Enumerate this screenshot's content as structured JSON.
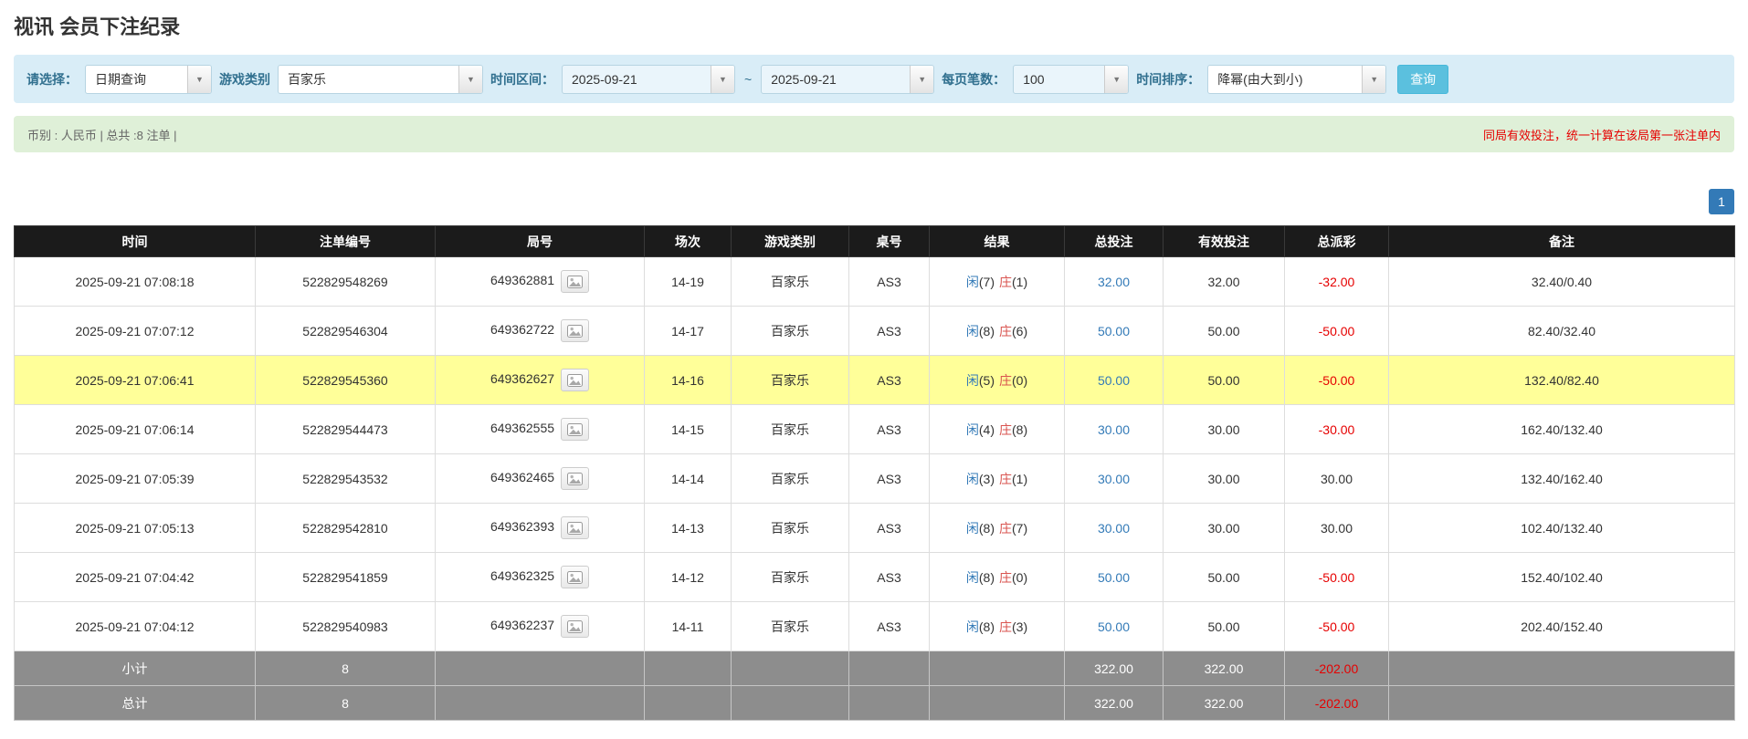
{
  "page": {
    "title": "视讯 会员下注纪录"
  },
  "icons": {
    "caret": "▼"
  },
  "filters": {
    "select_label": "请选择：",
    "select_value": "日期查询",
    "game_type_label": "游戏类别",
    "game_type_value": "百家乐",
    "time_range_label": "时间区间：",
    "date_from": "2025-09-21",
    "tilde": "~",
    "date_to": "2025-09-21",
    "page_size_label": "每页笔数：",
    "page_size_value": "100",
    "sort_label": "时间排序：",
    "sort_value": "降幂(由大到小)",
    "search_button": "查询"
  },
  "summary": {
    "left": "币别 : 人民币 | 总共 :8 注单 |",
    "right": "同局有效投注，统一计算在该局第一张注单内"
  },
  "pagination": {
    "page": "1"
  },
  "table": {
    "headers": [
      "时间",
      "注单编号",
      "局号",
      "场次",
      "游戏类别",
      "桌号",
      "结果",
      "总投注",
      "有效投注",
      "总派彩",
      "备注"
    ],
    "rows": [
      {
        "time": "2025-09-21 07:08:18",
        "bet_id": "522829548269",
        "round_id": "649362881",
        "session": "14-19",
        "game": "百家乐",
        "table_no": "AS3",
        "result": {
          "player_label": "闲",
          "player_score": "(7)",
          "banker_label": "庄",
          "banker_score": "(1)"
        },
        "total_bet": "32.00",
        "valid_bet": "32.00",
        "payout": "-32.00",
        "remark": "32.40/0.40",
        "highlighted": false
      },
      {
        "time": "2025-09-21 07:07:12",
        "bet_id": "522829546304",
        "round_id": "649362722",
        "session": "14-17",
        "game": "百家乐",
        "table_no": "AS3",
        "result": {
          "player_label": "闲",
          "player_score": "(8)",
          "banker_label": "庄",
          "banker_score": "(6)"
        },
        "total_bet": "50.00",
        "valid_bet": "50.00",
        "payout": "-50.00",
        "remark": "82.40/32.40",
        "highlighted": false
      },
      {
        "time": "2025-09-21 07:06:41",
        "bet_id": "522829545360",
        "round_id": "649362627",
        "session": "14-16",
        "game": "百家乐",
        "table_no": "AS3",
        "result": {
          "player_label": "闲",
          "player_score": "(5)",
          "banker_label": "庄",
          "banker_score": "(0)"
        },
        "total_bet": "50.00",
        "valid_bet": "50.00",
        "payout": "-50.00",
        "remark": "132.40/82.40",
        "highlighted": true
      },
      {
        "time": "2025-09-21 07:06:14",
        "bet_id": "522829544473",
        "round_id": "649362555",
        "session": "14-15",
        "game": "百家乐",
        "table_no": "AS3",
        "result": {
          "player_label": "闲",
          "player_score": "(4)",
          "banker_label": "庄",
          "banker_score": "(8)"
        },
        "total_bet": "30.00",
        "valid_bet": "30.00",
        "payout": "-30.00",
        "remark": "162.40/132.40",
        "highlighted": false
      },
      {
        "time": "2025-09-21 07:05:39",
        "bet_id": "522829543532",
        "round_id": "649362465",
        "session": "14-14",
        "game": "百家乐",
        "table_no": "AS3",
        "result": {
          "player_label": "闲",
          "player_score": "(3)",
          "banker_label": "庄",
          "banker_score": "(1)"
        },
        "total_bet": "30.00",
        "valid_bet": "30.00",
        "payout": "30.00",
        "remark": "132.40/162.40",
        "highlighted": false
      },
      {
        "time": "2025-09-21 07:05:13",
        "bet_id": "522829542810",
        "round_id": "649362393",
        "session": "14-13",
        "game": "百家乐",
        "table_no": "AS3",
        "result": {
          "player_label": "闲",
          "player_score": "(8)",
          "banker_label": "庄",
          "banker_score": "(7)"
        },
        "total_bet": "30.00",
        "valid_bet": "30.00",
        "payout": "30.00",
        "remark": "102.40/132.40",
        "highlighted": false
      },
      {
        "time": "2025-09-21 07:04:42",
        "bet_id": "522829541859",
        "round_id": "649362325",
        "session": "14-12",
        "game": "百家乐",
        "table_no": "AS3",
        "result": {
          "player_label": "闲",
          "player_score": "(8)",
          "banker_label": "庄",
          "banker_score": "(0)"
        },
        "total_bet": "50.00",
        "valid_bet": "50.00",
        "payout": "-50.00",
        "remark": "152.40/102.40",
        "highlighted": false
      },
      {
        "time": "2025-09-21 07:04:12",
        "bet_id": "522829540983",
        "round_id": "649362237",
        "session": "14-11",
        "game": "百家乐",
        "table_no": "AS3",
        "result": {
          "player_label": "闲",
          "player_score": "(8)",
          "banker_label": "庄",
          "banker_score": "(3)"
        },
        "total_bet": "50.00",
        "valid_bet": "50.00",
        "payout": "-50.00",
        "remark": "202.40/152.40",
        "highlighted": false
      }
    ],
    "subtotal": {
      "label": "小计",
      "count": "8",
      "total_bet": "322.00",
      "valid_bet": "322.00",
      "payout": "-202.00"
    },
    "total": {
      "label": "总计",
      "count": "8",
      "total_bet": "322.00",
      "valid_bet": "322.00",
      "payout": "-202.00"
    }
  }
}
